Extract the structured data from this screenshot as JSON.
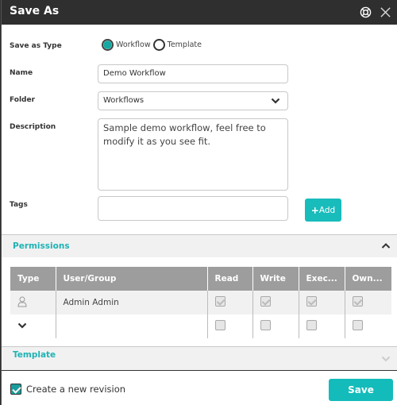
{
  "dialog": {
    "title": "Save As",
    "icons": {
      "help": "lifebuoy-icon",
      "close": "close-icon"
    }
  },
  "form": {
    "save_as_type": {
      "label": "Save as Type",
      "options": [
        {
          "label": "Workflow",
          "checked": true
        },
        {
          "label": "Template",
          "checked": false
        }
      ]
    },
    "name": {
      "label": "Name",
      "value": "Demo Workflow"
    },
    "folder": {
      "label": "Folder",
      "value": "Workflows"
    },
    "description": {
      "label": "Description",
      "value": "Sample demo workflow, feel free to modify it as you see fit."
    },
    "tags": {
      "label": "Tags",
      "value": "",
      "add_label": "Add"
    }
  },
  "permissions": {
    "title": "Permissions",
    "expanded": true,
    "columns": [
      "Type",
      "User/Group",
      "Read",
      "Write",
      "Exec...",
      "Own..."
    ],
    "rows": [
      {
        "type_icon": "user-icon",
        "user": "Admin Admin",
        "read": true,
        "write": true,
        "execute": true,
        "own": true,
        "disabled": true
      },
      {
        "type_icon": "chevron-down-icon",
        "user": "",
        "read": false,
        "write": false,
        "execute": false,
        "own": false,
        "disabled": false
      }
    ]
  },
  "template": {
    "title": "Template",
    "expanded": false
  },
  "footer": {
    "create_revision_label": "Create a new revision",
    "create_revision_checked": true,
    "save_label": "Save"
  },
  "colors": {
    "accent": "#13bcbb",
    "titlebar": "#2f2f2f",
    "section_title": "#1fb3b5",
    "table_header": "#9d9d9d"
  }
}
